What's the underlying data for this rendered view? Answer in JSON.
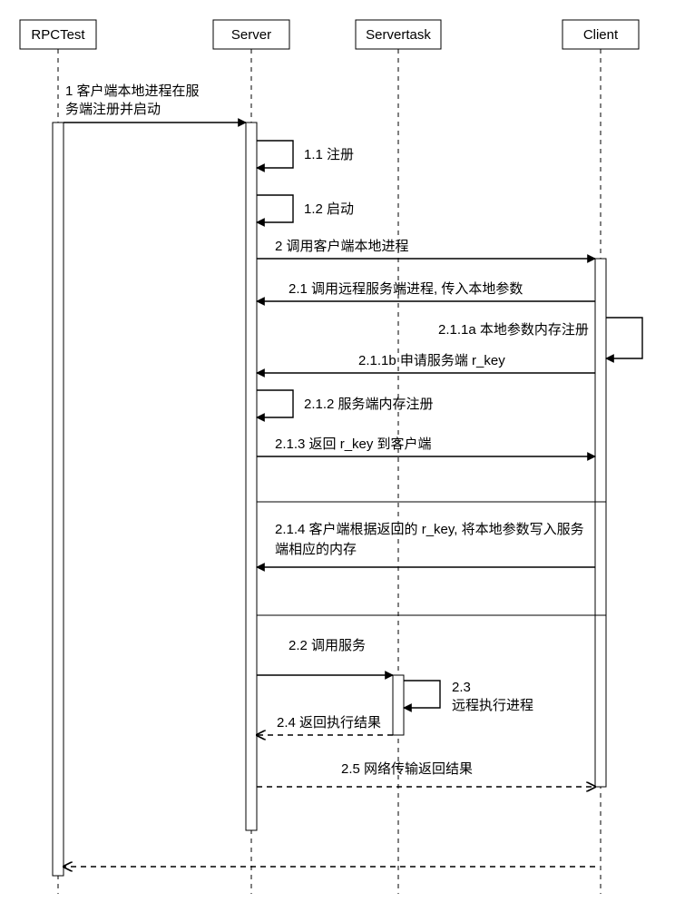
{
  "participants": {
    "rpctest": "RPCTest",
    "server": "Server",
    "servertask": "Servertask",
    "client": "Client"
  },
  "messages": {
    "m1a": "1 客户端本地进程在服",
    "m1b": "务端注册并启动",
    "m1_1": "1.1 注册",
    "m1_2": "1.2 启动",
    "m2": "2 调用客户端本地进程",
    "m2_1": "2.1 调用远程服务端进程, 传入本地参数",
    "m2_1_1a": "2.1.1a 本地参数内存注册",
    "m2_1_1b": "2.1.1b 申请服务端 r_key",
    "m2_1_2": "2.1.2 服务端内存注册",
    "m2_1_3": "2.1.3 返回 r_key 到客户端",
    "m2_1_4a": "2.1.4  客户端根据返回的 r_key, 将本地参数写入服务",
    "m2_1_4b": "端相应的内存",
    "m2_2": "2.2 调用服务",
    "m2_3a": "2.3",
    "m2_3b": "远程执行进程",
    "m2_4": "2.4 返回执行结果",
    "m2_5": "2.5 网络传输返回结果"
  },
  "chart_data": {
    "type": "sequence-diagram",
    "participants": [
      "RPCTest",
      "Server",
      "Servertask",
      "Client"
    ],
    "messages": [
      {
        "id": "1",
        "from": "RPCTest",
        "to": "Server",
        "label": "客户端本地进程在服务端注册并启动",
        "style": "sync"
      },
      {
        "id": "1.1",
        "from": "Server",
        "to": "Server",
        "label": "注册",
        "style": "self"
      },
      {
        "id": "1.2",
        "from": "Server",
        "to": "Server",
        "label": "启动",
        "style": "self"
      },
      {
        "id": "2",
        "from": "Server",
        "to": "Client",
        "label": "调用客户端本地进程",
        "style": "sync"
      },
      {
        "id": "2.1",
        "from": "Client",
        "to": "Server",
        "label": "调用远程服务端进程, 传入本地参数",
        "style": "sync"
      },
      {
        "id": "2.1.1a",
        "from": "Client",
        "to": "Client",
        "label": "本地参数内存注册",
        "style": "self"
      },
      {
        "id": "2.1.1b",
        "from": "Client",
        "to": "Server",
        "label": "申请服务端 r_key",
        "style": "sync"
      },
      {
        "id": "2.1.2",
        "from": "Server",
        "to": "Server",
        "label": "服务端内存注册",
        "style": "self"
      },
      {
        "id": "2.1.3",
        "from": "Server",
        "to": "Client",
        "label": "返回 r_key 到客户端",
        "style": "sync"
      },
      {
        "id": "2.1.4",
        "from": "Client",
        "to": "Server",
        "label": "客户端根据返回的 r_key, 将本地参数写入服务端相应的内存",
        "style": "sync"
      },
      {
        "id": "2.2",
        "from": "Server",
        "to": "Servertask",
        "label": "调用服务",
        "style": "sync"
      },
      {
        "id": "2.3",
        "from": "Servertask",
        "to": "Servertask",
        "label": "远程执行进程",
        "style": "self"
      },
      {
        "id": "2.4",
        "from": "Servertask",
        "to": "Server",
        "label": "返回执行结果",
        "style": "return"
      },
      {
        "id": "2.5",
        "from": "Server",
        "to": "Client",
        "label": "网络传输返回结果",
        "style": "return"
      },
      {
        "id": "return",
        "from": "Client",
        "to": "RPCTest",
        "label": "",
        "style": "return"
      }
    ]
  }
}
